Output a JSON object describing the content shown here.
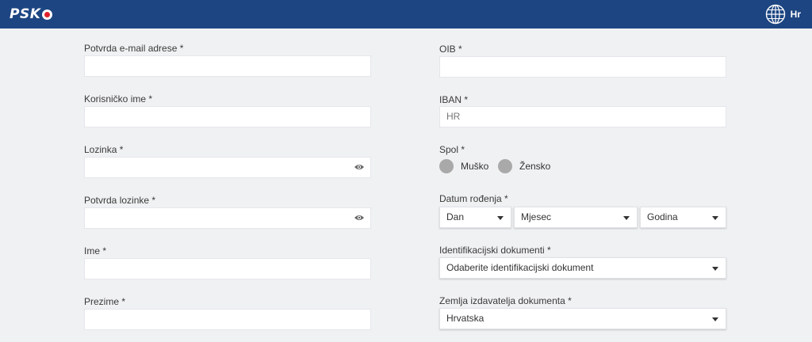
{
  "header": {
    "logo": "PSK",
    "language": "Hr"
  },
  "left_fields": [
    {
      "label": "Potvrda e-mail adrese *",
      "value": ""
    },
    {
      "label": "Korisničko ime *",
      "value": ""
    },
    {
      "label": "Lozinka *",
      "value": ""
    },
    {
      "label": "Potvrda lozinke *",
      "value": ""
    },
    {
      "label": "Ime *",
      "value": ""
    },
    {
      "label": "Prezime *",
      "value": ""
    }
  ],
  "right": {
    "oib": {
      "label": "OIB *",
      "value": ""
    },
    "iban": {
      "label": "IBAN *",
      "placeholder": "HR"
    },
    "gender": {
      "label": "Spol *",
      "options": [
        "Muško",
        "Žensko"
      ]
    },
    "birthdate": {
      "label": "Datum rođenja *",
      "day": "Dan",
      "month": "Mjesec",
      "year": "Godina"
    },
    "id_document": {
      "label": "Identifikacijski dokumenti *",
      "value": "Odaberite identifikacijski dokument"
    },
    "issuing_country": {
      "label": "Zemlja izdavatelja dokumenta *",
      "value": "Hrvatska"
    }
  },
  "colors": {
    "header": "#1c4582",
    "background": "#f0f1f3",
    "radio": "#a9a9a9"
  },
  "icons": [
    "globe-icon",
    "eye-icon",
    "caret-down-icon",
    "soccer-ball-icon"
  ]
}
